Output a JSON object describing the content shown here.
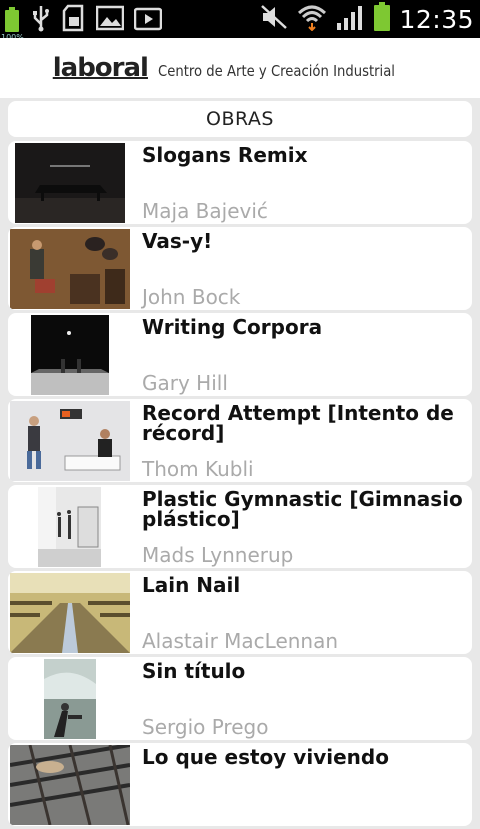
{
  "status_bar": {
    "battery_percent": "100%",
    "time": "12:35",
    "left_icons": [
      "battery-icon",
      "usb-icon",
      "sd-card-icon",
      "image-icon",
      "play-store-icon"
    ],
    "right_icons": [
      "mute-icon",
      "wifi-icon",
      "signal-icon",
      "battery-icon"
    ]
  },
  "header": {
    "logo_word": "laboral",
    "logo_subtitle": "Centro de Arte y Creación Industrial"
  },
  "section": {
    "title": "OBRAS"
  },
  "items": [
    {
      "title": "Slogans Remix",
      "artist": "Maja Bajević"
    },
    {
      "title": "Vas-y!",
      "artist": "John Bock"
    },
    {
      "title": "Writing Corpora",
      "artist": "Gary Hill"
    },
    {
      "title": "Record Attempt [Intento de récord]",
      "artist": "Thom Kubli"
    },
    {
      "title": "Plastic Gymnastic [Gimnasio plástico]",
      "artist": "Mads Lynnerup"
    },
    {
      "title": "Lain Nail",
      "artist": "Alastair MacLennan"
    },
    {
      "title": "Sin título",
      "artist": "Sergio Prego"
    },
    {
      "title": "Lo que estoy viviendo",
      "artist": ""
    }
  ]
}
